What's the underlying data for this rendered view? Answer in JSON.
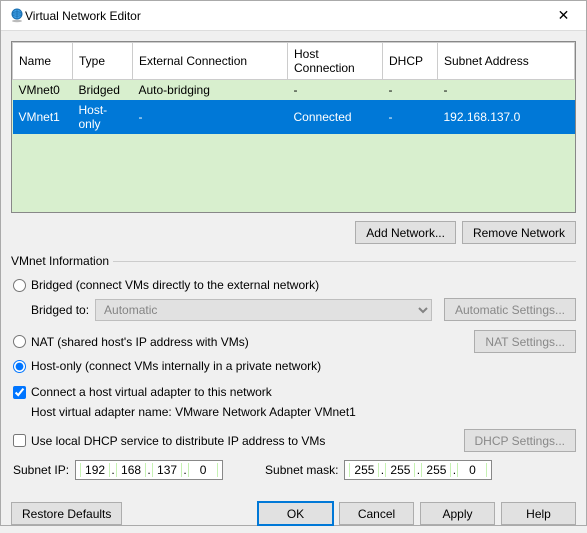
{
  "window": {
    "title": "Virtual Network Editor",
    "close_symbol": "✕"
  },
  "grid": {
    "headers": [
      "Name",
      "Type",
      "External Connection",
      "Host Connection",
      "DHCP",
      "Subnet Address"
    ],
    "rows": [
      {
        "name": "VMnet0",
        "type": "Bridged",
        "ext": "Auto-bridging",
        "host": "-",
        "dhcp": "-",
        "subnet": "-"
      },
      {
        "name": "VMnet1",
        "type": "Host-only",
        "ext": "-",
        "host": "Connected",
        "dhcp": "-",
        "subnet": "192.168.137.0"
      }
    ],
    "selected_index": 1
  },
  "buttons": {
    "add_network": "Add Network...",
    "remove_network": "Remove Network"
  },
  "info": {
    "legend": "VMnet Information",
    "bridged_label": "Bridged (connect VMs directly to the external network)",
    "bridged_to_label": "Bridged to:",
    "bridged_to_value": "Automatic",
    "auto_settings_btn": "Automatic Settings...",
    "nat_label": "NAT (shared host's IP address with VMs)",
    "nat_settings_btn": "NAT Settings...",
    "hostonly_label": "Host-only (connect VMs internally in a private network)",
    "selected_mode": "hostonly",
    "connect_adapter_checked": true,
    "connect_adapter_label": "Connect a host virtual adapter to this network",
    "adapter_name_prefix": "Host virtual adapter name: ",
    "adapter_name_value": "VMware Network Adapter VMnet1",
    "use_dhcp_checked": false,
    "use_dhcp_label": "Use local DHCP service to distribute IP address to VMs",
    "dhcp_settings_btn": "DHCP Settings...",
    "subnet_ip_label": "Subnet IP:",
    "subnet_ip": [
      "192",
      "168",
      "137",
      "0"
    ],
    "subnet_mask_label": "Subnet mask:",
    "subnet_mask": [
      "255",
      "255",
      "255",
      "0"
    ]
  },
  "footer": {
    "restore": "Restore Defaults",
    "ok": "OK",
    "cancel": "Cancel",
    "apply": "Apply",
    "help": "Help"
  }
}
